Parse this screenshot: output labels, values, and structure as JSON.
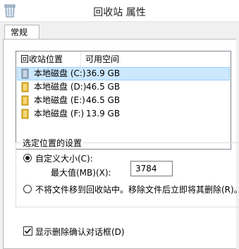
{
  "window": {
    "title": "回收站 属性",
    "icon": "recycle-bin-icon"
  },
  "tabs": [
    {
      "label": "常规"
    }
  ],
  "drive_list": {
    "columns": [
      "回收站位置",
      "可用空间"
    ],
    "rows": [
      {
        "name": "本地磁盘 (C:)",
        "space": "36.9 GB",
        "icon": "system-drive-icon",
        "selected": true
      },
      {
        "name": "本地磁盘 (D:)",
        "space": "46.5 GB",
        "icon": "drive-icon",
        "selected": false
      },
      {
        "name": "本地磁盘 (E:)",
        "space": "46.5 GB",
        "icon": "drive-icon",
        "selected": false
      },
      {
        "name": "本地磁盘 (F:)",
        "space": "13.9 GB",
        "icon": "drive-icon",
        "selected": false
      }
    ]
  },
  "settings": {
    "group_label": "选定位置的设置",
    "custom_size_label": "自定义大小(C):",
    "custom_size_selected": true,
    "max_value_label": "最大值(MB)(X):",
    "max_value": "3784",
    "no_move_label": "不将文件移到回收站中。移除文件后立即将其删除(R)。",
    "no_move_selected": false
  },
  "confirm": {
    "label": "显示删除确认对话框(D)",
    "checked": true
  },
  "colors": {
    "selection": "#cce8ff",
    "drive_folder": "#e8b931"
  }
}
